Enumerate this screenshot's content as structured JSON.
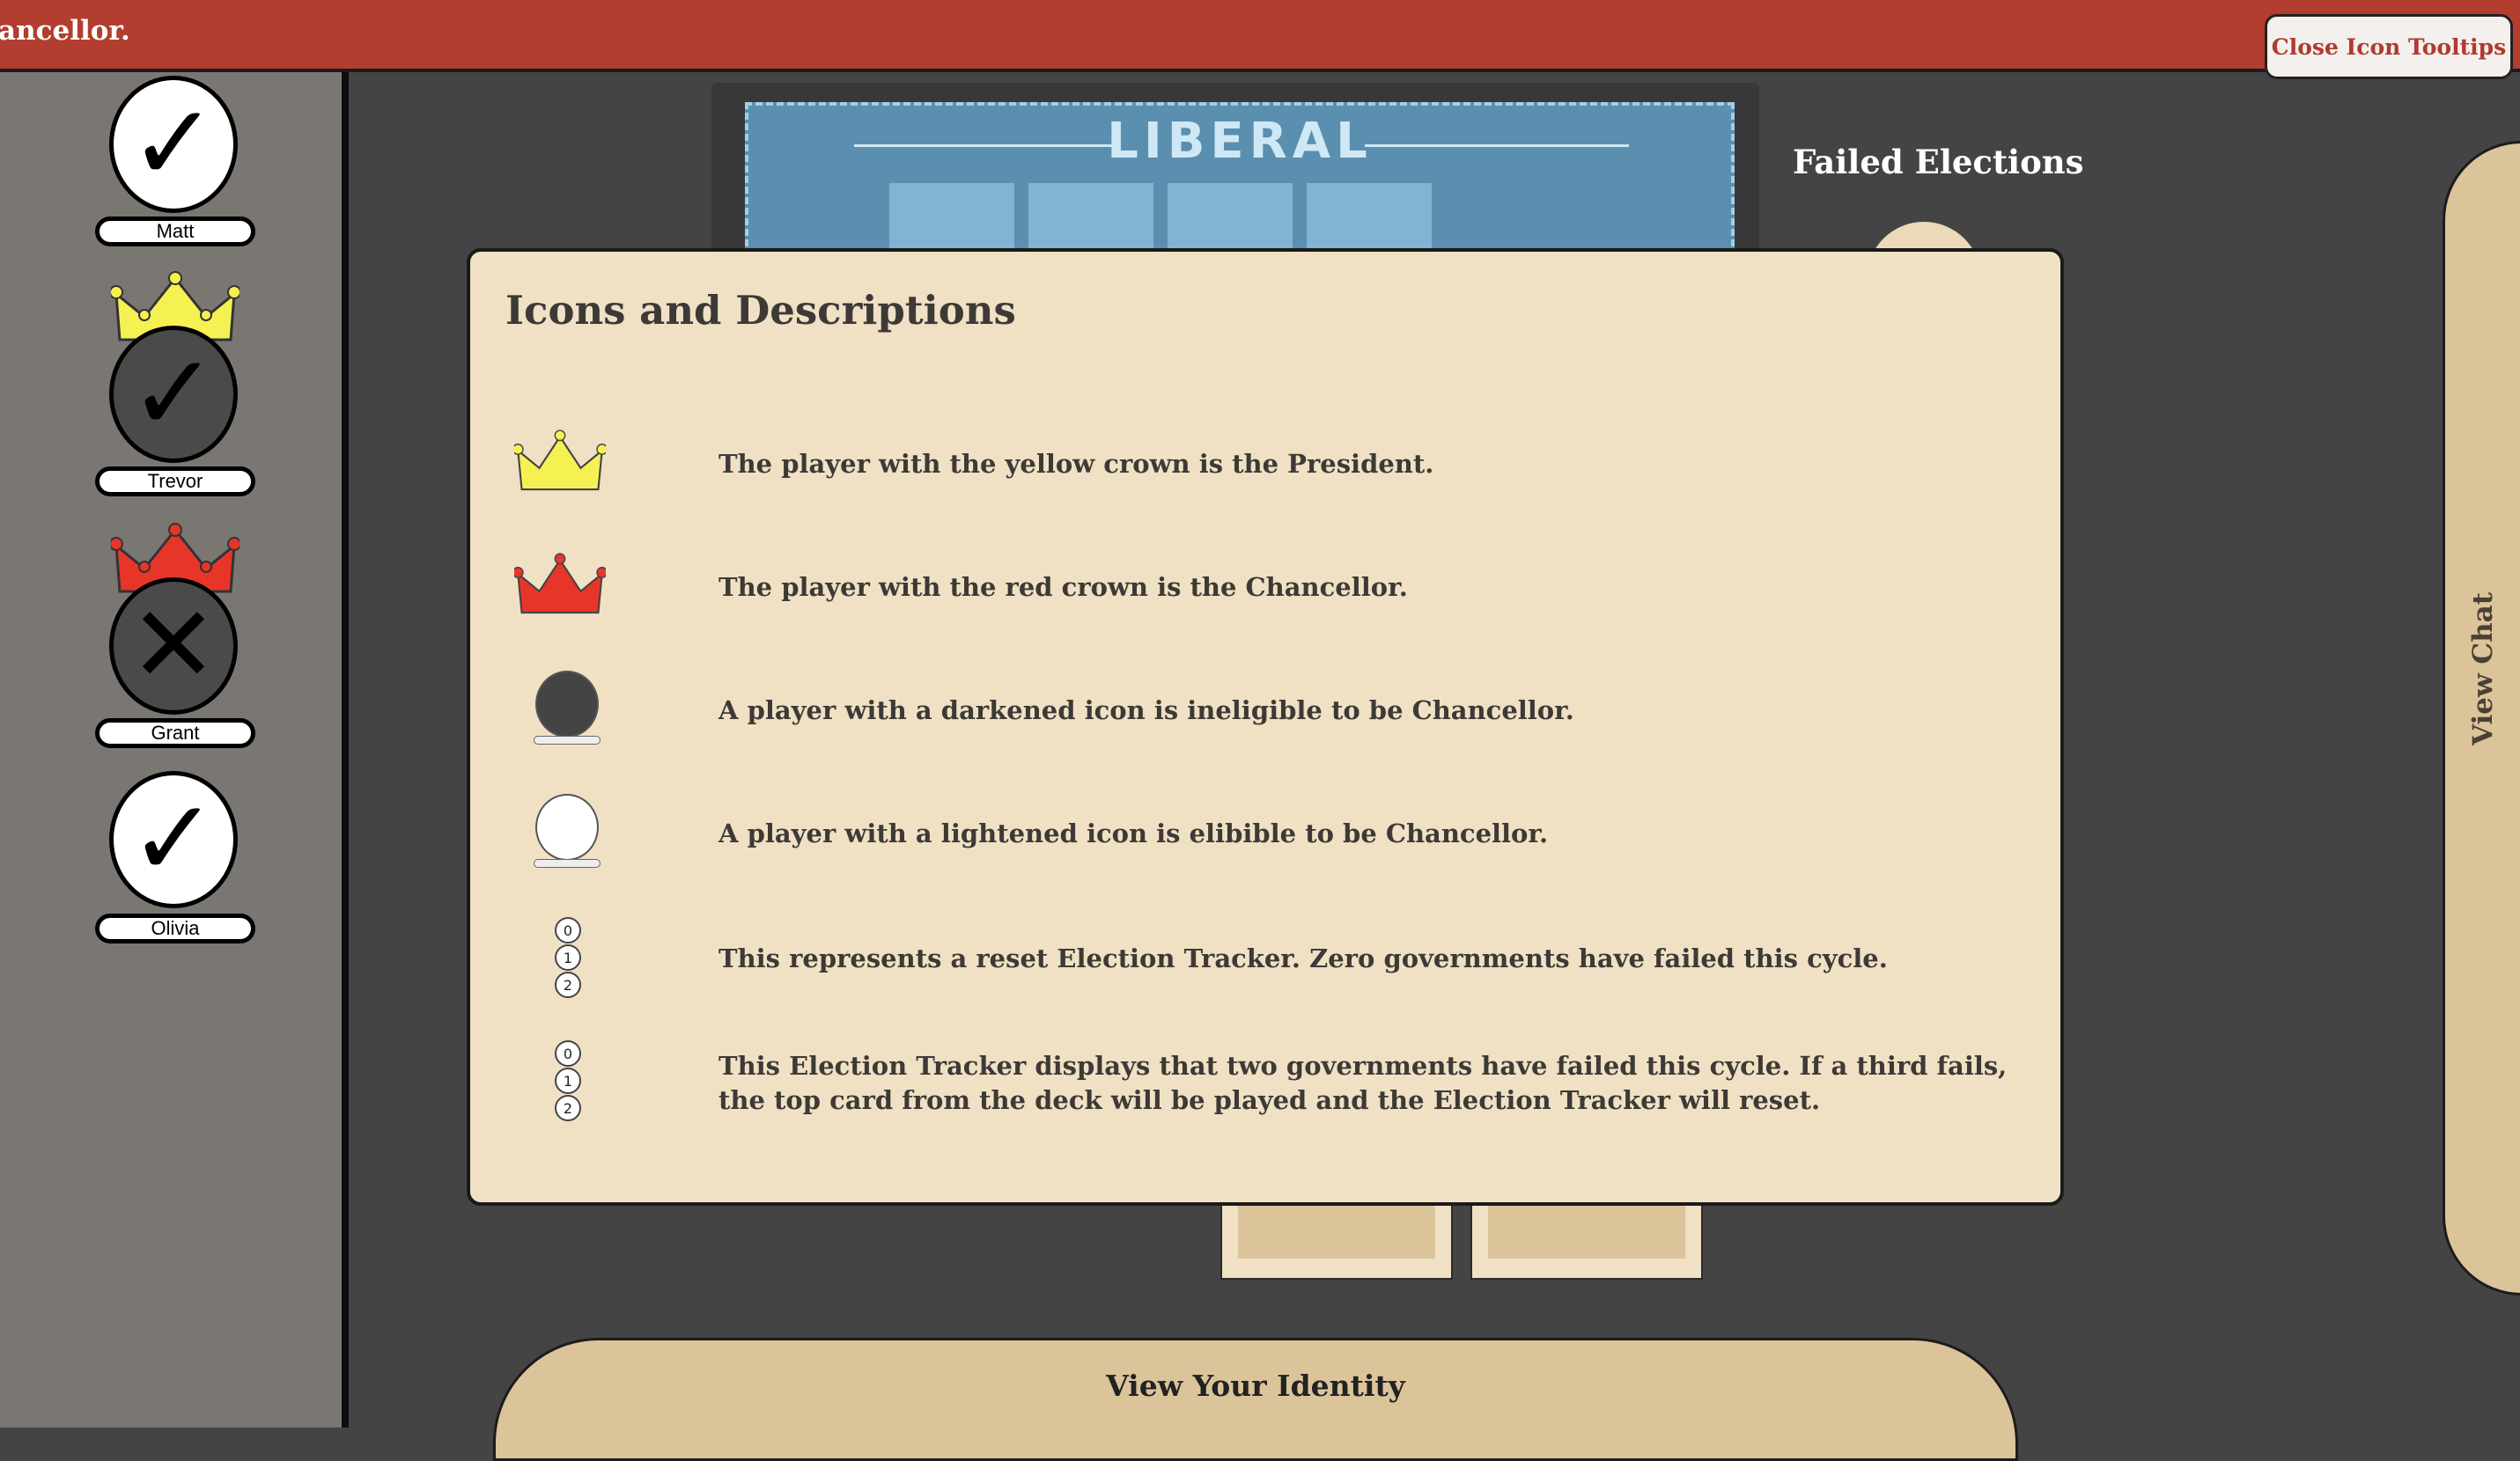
{
  "top_banner": {
    "message": "ancellor."
  },
  "close_tooltips_button": "Close Icon Tooltips",
  "players": [
    {
      "name": "Matt",
      "vote_mark": "✓",
      "icon_state": "light",
      "crown": "none"
    },
    {
      "name": "Trevor",
      "vote_mark": "✓",
      "icon_state": "dark",
      "crown": "yellow"
    },
    {
      "name": "Grant",
      "vote_mark": "✕",
      "icon_state": "dark",
      "crown": "red"
    },
    {
      "name": "Olivia",
      "vote_mark": "✓",
      "icon_state": "light",
      "crown": "none"
    }
  ],
  "board": {
    "title": "LIBERAL"
  },
  "failed_elections_label": "Failed Elections",
  "chat_tab_label": "View Chat",
  "identity_button": "View Your Identity",
  "modal": {
    "title": "Icons and Descriptions",
    "rows": [
      {
        "icon": "yellow-crown-icon",
        "text": "The player with the yellow crown is the President."
      },
      {
        "icon": "red-crown-icon",
        "text": "The player with the red crown is the Chancellor."
      },
      {
        "icon": "darkened-player-icon",
        "text": "A player with a darkened icon is ineligible to be Chancellor."
      },
      {
        "icon": "lightened-player-icon",
        "text": "A player with a lightened icon is elibible to be Chancellor."
      },
      {
        "icon": "election-tracker-reset-icon",
        "text": "This represents a reset Election Tracker. Zero governments have failed this cycle."
      },
      {
        "icon": "election-tracker-two-failed-icon",
        "text": "This Election Tracker displays that two governments have failed this cycle. If a third fails, the top card from the deck will be played and the Election Tracker will reset."
      }
    ],
    "tracker_numbers": [
      "0",
      "1",
      "2"
    ]
  },
  "colors": {
    "banner_red": "#b33d2f",
    "president_yellow": "#f6f152",
    "chancellor_red": "#e8352a",
    "modal_bg": "#f0e1c5",
    "tab_tan": "#dcc49a"
  }
}
